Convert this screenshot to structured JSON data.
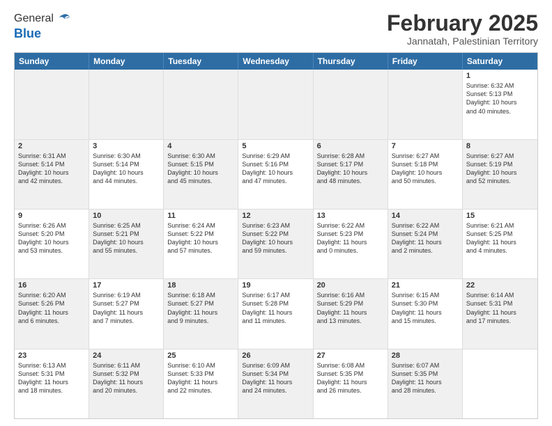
{
  "header": {
    "logo_line1": "General",
    "logo_line2": "Blue",
    "month_title": "February 2025",
    "subtitle": "Jannatah, Palestinian Territory"
  },
  "days_of_week": [
    "Sunday",
    "Monday",
    "Tuesday",
    "Wednesday",
    "Thursday",
    "Friday",
    "Saturday"
  ],
  "rows": [
    [
      {
        "day": "",
        "text": "",
        "shaded": true
      },
      {
        "day": "",
        "text": "",
        "shaded": true
      },
      {
        "day": "",
        "text": "",
        "shaded": true
      },
      {
        "day": "",
        "text": "",
        "shaded": true
      },
      {
        "day": "",
        "text": "",
        "shaded": true
      },
      {
        "day": "",
        "text": "",
        "shaded": true
      },
      {
        "day": "1",
        "text": "Sunrise: 6:32 AM\nSunset: 5:13 PM\nDaylight: 10 hours\nand 40 minutes.",
        "shaded": false
      }
    ],
    [
      {
        "day": "2",
        "text": "Sunrise: 6:31 AM\nSunset: 5:14 PM\nDaylight: 10 hours\nand 42 minutes.",
        "shaded": true
      },
      {
        "day": "3",
        "text": "Sunrise: 6:30 AM\nSunset: 5:14 PM\nDaylight: 10 hours\nand 44 minutes.",
        "shaded": false
      },
      {
        "day": "4",
        "text": "Sunrise: 6:30 AM\nSunset: 5:15 PM\nDaylight: 10 hours\nand 45 minutes.",
        "shaded": true
      },
      {
        "day": "5",
        "text": "Sunrise: 6:29 AM\nSunset: 5:16 PM\nDaylight: 10 hours\nand 47 minutes.",
        "shaded": false
      },
      {
        "day": "6",
        "text": "Sunrise: 6:28 AM\nSunset: 5:17 PM\nDaylight: 10 hours\nand 48 minutes.",
        "shaded": true
      },
      {
        "day": "7",
        "text": "Sunrise: 6:27 AM\nSunset: 5:18 PM\nDaylight: 10 hours\nand 50 minutes.",
        "shaded": false
      },
      {
        "day": "8",
        "text": "Sunrise: 6:27 AM\nSunset: 5:19 PM\nDaylight: 10 hours\nand 52 minutes.",
        "shaded": true
      }
    ],
    [
      {
        "day": "9",
        "text": "Sunrise: 6:26 AM\nSunset: 5:20 PM\nDaylight: 10 hours\nand 53 minutes.",
        "shaded": false
      },
      {
        "day": "10",
        "text": "Sunrise: 6:25 AM\nSunset: 5:21 PM\nDaylight: 10 hours\nand 55 minutes.",
        "shaded": true
      },
      {
        "day": "11",
        "text": "Sunrise: 6:24 AM\nSunset: 5:22 PM\nDaylight: 10 hours\nand 57 minutes.",
        "shaded": false
      },
      {
        "day": "12",
        "text": "Sunrise: 6:23 AM\nSunset: 5:22 PM\nDaylight: 10 hours\nand 59 minutes.",
        "shaded": true
      },
      {
        "day": "13",
        "text": "Sunrise: 6:22 AM\nSunset: 5:23 PM\nDaylight: 11 hours\nand 0 minutes.",
        "shaded": false
      },
      {
        "day": "14",
        "text": "Sunrise: 6:22 AM\nSunset: 5:24 PM\nDaylight: 11 hours\nand 2 minutes.",
        "shaded": true
      },
      {
        "day": "15",
        "text": "Sunrise: 6:21 AM\nSunset: 5:25 PM\nDaylight: 11 hours\nand 4 minutes.",
        "shaded": false
      }
    ],
    [
      {
        "day": "16",
        "text": "Sunrise: 6:20 AM\nSunset: 5:26 PM\nDaylight: 11 hours\nand 6 minutes.",
        "shaded": true
      },
      {
        "day": "17",
        "text": "Sunrise: 6:19 AM\nSunset: 5:27 PM\nDaylight: 11 hours\nand 7 minutes.",
        "shaded": false
      },
      {
        "day": "18",
        "text": "Sunrise: 6:18 AM\nSunset: 5:27 PM\nDaylight: 11 hours\nand 9 minutes.",
        "shaded": true
      },
      {
        "day": "19",
        "text": "Sunrise: 6:17 AM\nSunset: 5:28 PM\nDaylight: 11 hours\nand 11 minutes.",
        "shaded": false
      },
      {
        "day": "20",
        "text": "Sunrise: 6:16 AM\nSunset: 5:29 PM\nDaylight: 11 hours\nand 13 minutes.",
        "shaded": true
      },
      {
        "day": "21",
        "text": "Sunrise: 6:15 AM\nSunset: 5:30 PM\nDaylight: 11 hours\nand 15 minutes.",
        "shaded": false
      },
      {
        "day": "22",
        "text": "Sunrise: 6:14 AM\nSunset: 5:31 PM\nDaylight: 11 hours\nand 17 minutes.",
        "shaded": true
      }
    ],
    [
      {
        "day": "23",
        "text": "Sunrise: 6:13 AM\nSunset: 5:31 PM\nDaylight: 11 hours\nand 18 minutes.",
        "shaded": false
      },
      {
        "day": "24",
        "text": "Sunrise: 6:11 AM\nSunset: 5:32 PM\nDaylight: 11 hours\nand 20 minutes.",
        "shaded": true
      },
      {
        "day": "25",
        "text": "Sunrise: 6:10 AM\nSunset: 5:33 PM\nDaylight: 11 hours\nand 22 minutes.",
        "shaded": false
      },
      {
        "day": "26",
        "text": "Sunrise: 6:09 AM\nSunset: 5:34 PM\nDaylight: 11 hours\nand 24 minutes.",
        "shaded": true
      },
      {
        "day": "27",
        "text": "Sunrise: 6:08 AM\nSunset: 5:35 PM\nDaylight: 11 hours\nand 26 minutes.",
        "shaded": false
      },
      {
        "day": "28",
        "text": "Sunrise: 6:07 AM\nSunset: 5:35 PM\nDaylight: 11 hours\nand 28 minutes.",
        "shaded": true
      },
      {
        "day": "",
        "text": "",
        "shaded": false
      }
    ]
  ]
}
